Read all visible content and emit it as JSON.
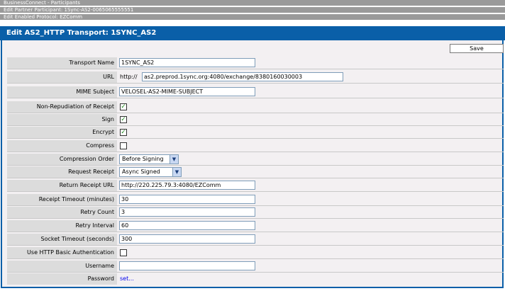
{
  "breadcrumbs": [
    "BusinessConnect - Participants",
    "Edit Partner Participant: 1Sync-AS2-0065065555551",
    "Edit Enabled Protocol: EZComm"
  ],
  "header_title": "Edit AS2_HTTP Transport: 1SYNC_AS2",
  "save_label": "Save",
  "fields": {
    "transport_name": {
      "label": "Transport Name",
      "value": "1SYNC_AS2"
    },
    "url": {
      "label": "URL",
      "prefix": "http://",
      "value": "as2.preprod.1sync.org:4080/exchange/8380160030003"
    },
    "mime_subject": {
      "label": "MIME Subject",
      "value": "VELOSEL-AS2-MIME-SUBJECT"
    },
    "non_repudiation": {
      "label": "Non-Repudiation of Receipt",
      "checked": true,
      "mark": "✓"
    },
    "sign": {
      "label": "Sign",
      "checked": true,
      "mark": "✓"
    },
    "encrypt": {
      "label": "Encrypt",
      "checked": true,
      "mark": "✓"
    },
    "compress": {
      "label": "Compress",
      "checked": false,
      "mark": ""
    },
    "compression_order": {
      "label": "Compression Order",
      "value": "Before Signing"
    },
    "request_receipt": {
      "label": "Request Receipt",
      "value": "Async Signed"
    },
    "return_receipt_url": {
      "label": "Return Receipt URL",
      "value": "http://220.225.79.3:4080/EZComm"
    },
    "receipt_timeout": {
      "label": "Receipt Timeout (minutes)",
      "value": "30"
    },
    "retry_count": {
      "label": "Retry Count",
      "value": "3"
    },
    "retry_interval": {
      "label": "Retry Interval",
      "value": "60"
    },
    "socket_timeout": {
      "label": "Socket Timeout (seconds)",
      "value": "300"
    },
    "http_basic_auth": {
      "label": "Use HTTP Basic Authentication",
      "checked": false,
      "mark": ""
    },
    "username": {
      "label": "Username",
      "value": ""
    },
    "password": {
      "label": "Password",
      "link": "set..."
    }
  },
  "icons": {
    "dropdown_arrow": "▼"
  },
  "colors": {
    "header_bg": "#0a5fa8",
    "breadcrumb_bg": "#9a9a9a",
    "label_bg": "#dcdcdc",
    "check": "#1f8a1f"
  }
}
